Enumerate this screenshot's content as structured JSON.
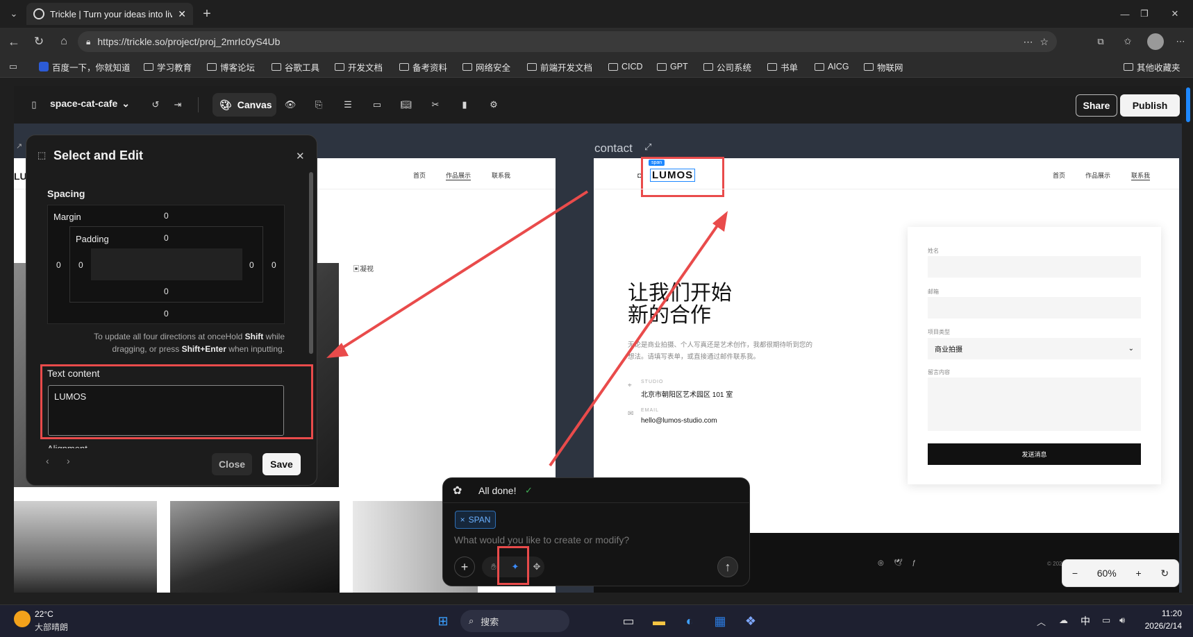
{
  "browser": {
    "tab_title": "Trickle | Turn your ideas into live ap",
    "url": "https://trickle.so/project/proj_2mrIc0yS4Ub",
    "bookmarks": [
      "百度一下，你就知道",
      "学习教育",
      "博客论坛",
      "谷歌工具",
      "开发文档",
      "备考资料",
      "网络安全",
      "前端开发文档",
      "CICD",
      "GPT",
      "公司系统",
      "书单",
      "AICG",
      "物联网"
    ],
    "other_bookmarks": "其他收藏夹"
  },
  "app": {
    "project_name": "space-cat-cafe",
    "canvas_label": "Canvas",
    "share_label": "Share",
    "publish_label": "Publish",
    "page_label": "contact",
    "zoom": "60%"
  },
  "left_page": {
    "logo_partial": "LU",
    "nav": [
      "首页",
      "作品展示",
      "联系我"
    ],
    "broken_img_alt": "凝视"
  },
  "right_page": {
    "selection_tag": "span",
    "logo": "LUMOS",
    "nav": [
      "首页",
      "作品展示",
      "联系我"
    ],
    "heading_line1": "让我们开始",
    "heading_line2": "新的合作",
    "intro_line1": "无论是商业拍摄、个人写真还是艺术创作，我都很期待听到您的",
    "intro_line2": "想法。请填写表单，或直接通过邮件联系我。",
    "studio_label": "STUDIO",
    "studio_value": "北京市朝阳区艺术园区 101 室",
    "email_label": "EMAIL",
    "email_value": "hello@lumos-studio.com",
    "form": {
      "name_label": "姓名",
      "email_label": "邮箱",
      "type_label": "项目类型",
      "type_value": "商业拍摄",
      "message_label": "留言内容",
      "submit_label": "发送消息"
    },
    "footer_copy": "© 202"
  },
  "dialog": {
    "title": "Select and Edit",
    "spacing_label": "Spacing",
    "margin_label": "Margin",
    "padding_label": "Padding",
    "margin": {
      "top": "0",
      "right": "0",
      "bottom": "0",
      "left": "0"
    },
    "padding": {
      "top": "0",
      "right": "0",
      "bottom": "0",
      "left": "0"
    },
    "hint_line1_pre": "To update all four directions at onceHold ",
    "hint_shift": "Shift",
    "hint_line1_post": " while",
    "hint_line2_pre": "dragging, or press ",
    "hint_shift_enter": "Shift+Enter",
    "hint_line2_post": " when inputting.",
    "text_content_label": "Text content",
    "text_content_value": "LUMOS",
    "alignment_label_partial": "Alignment",
    "close_label": "Close",
    "save_label": "Save"
  },
  "chat": {
    "status": "All done!",
    "chip_label": "SPAN",
    "placeholder": "What would you like to create or modify?"
  },
  "taskbar": {
    "temp": "22°C",
    "weather": "大部晴朗",
    "search": "搜索",
    "ime": "中",
    "time": "11:20",
    "date": "2026/2/14"
  },
  "colors": {
    "accent_red": "#e94b4b",
    "selection_blue": "#1e88ff"
  }
}
